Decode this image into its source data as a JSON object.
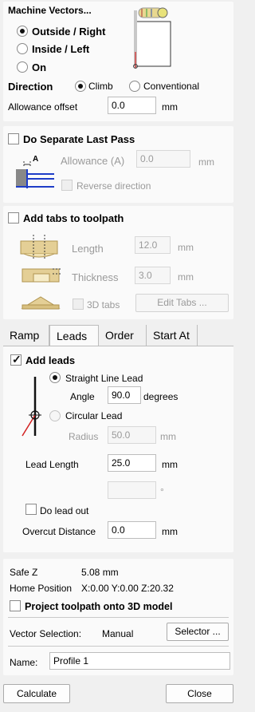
{
  "machine_vectors": {
    "title": "Machine Vectors...",
    "options": [
      "Outside / Right",
      "Inside / Left",
      "On"
    ],
    "selected": "Outside / Right",
    "direction_label": "Direction",
    "direction_options": [
      "Climb",
      "Conventional"
    ],
    "direction_selected": "Climb",
    "allowance_label": "Allowance offset",
    "allowance_value": "0.0",
    "allowance_unit": "mm"
  },
  "separate_last_pass": {
    "label": "Do Separate Last Pass",
    "checked": false,
    "allowance_label": "Allowance (A)",
    "allowance_value": "0.0",
    "allowance_unit": "mm",
    "icon_letter": "A",
    "reverse_label": "Reverse direction"
  },
  "tabs_section": {
    "label": "Add tabs to toolpath",
    "checked": false,
    "length_label": "Length",
    "length_value": "12.0",
    "length_unit": "mm",
    "thickness_label": "Thickness",
    "thickness_value": "3.0",
    "thickness_unit": "mm",
    "tabs_3d_label": "3D tabs",
    "edit_tabs_label": "Edit Tabs ..."
  },
  "tab_bar": {
    "tabs": [
      "Ramp",
      "Leads",
      "Order",
      "Start At"
    ],
    "active": "Leads"
  },
  "leads": {
    "add_leads_label": "Add leads",
    "add_leads_checked": true,
    "straight_label": "Straight Line Lead",
    "angle_label": "Angle",
    "angle_value": "90.0",
    "angle_unit": "degrees",
    "circular_label": "Circular Lead",
    "radius_label": "Radius",
    "radius_value": "50.0",
    "radius_unit": "mm",
    "lead_length_label": "Lead Length",
    "lead_length_value": "25.0",
    "lead_length_unit": "mm",
    "degree_unit": "°",
    "do_lead_out_label": "Do lead out",
    "overcut_label": "Overcut Distance",
    "overcut_value": "0.0",
    "overcut_unit": "mm"
  },
  "info": {
    "safe_z_label": "Safe Z",
    "safe_z_value": "5.08 mm",
    "home_label": "Home Position",
    "home_value": "X:0.00 Y:0.00 Z:20.32",
    "project_label": "Project toolpath onto 3D model",
    "vector_selection_label": "Vector Selection:",
    "vector_selection_value": "Manual",
    "selector_label": "Selector ...",
    "name_label": "Name:",
    "name_value": "Profile 1"
  },
  "footer": {
    "calculate_label": "Calculate",
    "close_label": "Close"
  },
  "colors": {
    "panel_bg": "#fafafa",
    "window_bg": "#f0f0f0",
    "lead_line_red": "#d22020",
    "tool_blue": "#1e3dc8"
  }
}
